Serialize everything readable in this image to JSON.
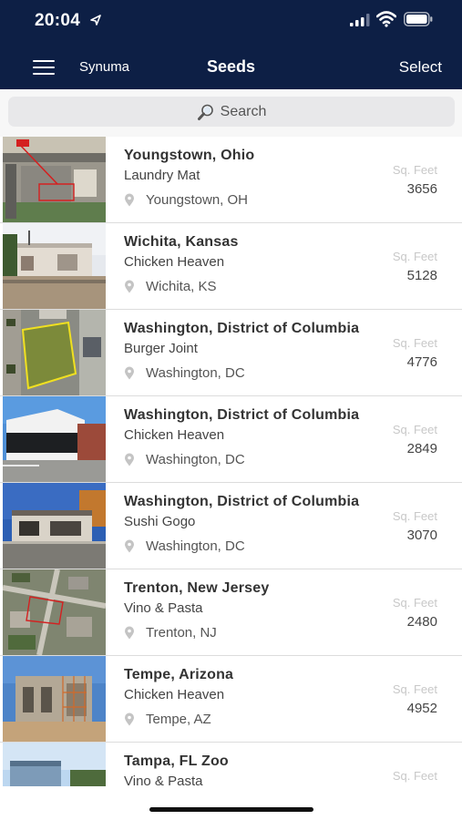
{
  "status": {
    "time": "20:04"
  },
  "nav": {
    "brand": "Synuma",
    "title": "Seeds",
    "select_label": "Select"
  },
  "search": {
    "placeholder": "Search"
  },
  "colors": {
    "header": "#0d1f45",
    "divider": "#dcdcdc",
    "label_gray": "#c8c8c8"
  },
  "icons": {
    "menu": "hamburger-icon",
    "search": "magnifier-icon",
    "location": "map-pin-icon"
  },
  "sq_label": "Sq. Feet",
  "seeds": [
    {
      "city": "Youngstown, Ohio",
      "business": "Laundry Mat",
      "location": "Youngstown, OH",
      "sq_feet": "3656",
      "thumb": "aerial-parking"
    },
    {
      "city": "Wichita, Kansas",
      "business": "Chicken Heaven",
      "location": "Wichita, KS",
      "sq_feet": "5128",
      "thumb": "street-building"
    },
    {
      "city": "Washington, District of Columbia",
      "business": "Burger Joint",
      "location": "Washington, DC",
      "sq_feet": "4776",
      "thumb": "aerial-lot"
    },
    {
      "city": "Washington, District of Columbia",
      "business": "Chicken Heaven",
      "location": "Washington, DC",
      "sq_feet": "2849",
      "thumb": "white-building"
    },
    {
      "city": "Washington, District of Columbia",
      "business": "Sushi Gogo",
      "location": "Washington, DC",
      "sq_feet": "3070",
      "thumb": "strip-mall"
    },
    {
      "city": "Trenton, New Jersey",
      "business": "Vino & Pasta",
      "location": "Trenton, NJ",
      "sq_feet": "2480",
      "thumb": "aerial-grid"
    },
    {
      "city": "Tempe, Arizona",
      "business": "Chicken Heaven",
      "location": "Tempe, AZ",
      "sq_feet": "4952",
      "thumb": "construction"
    },
    {
      "city": "Tampa, FL Zoo",
      "business": "Vino & Pasta",
      "location": "",
      "sq_feet": "",
      "thumb": "sky-building"
    }
  ]
}
